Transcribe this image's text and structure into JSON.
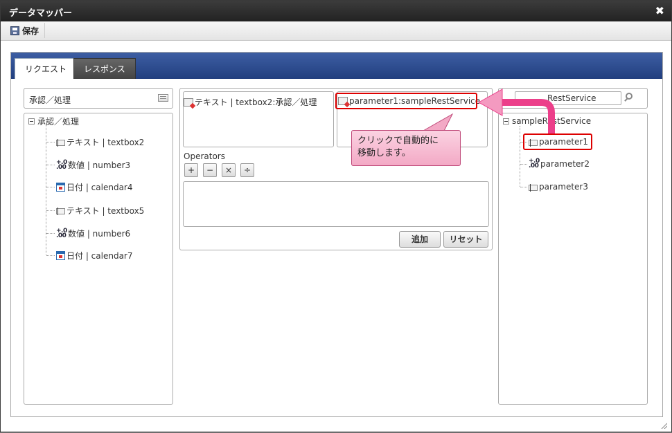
{
  "window": {
    "title": "データマッパー",
    "close_glyph": "✖"
  },
  "toolbar": {
    "save_label": "保存"
  },
  "tabs": [
    {
      "label": "リクエスト",
      "active": true
    },
    {
      "label": "レスポンス",
      "active": false
    }
  ],
  "left_panel": {
    "header": "承認／処理",
    "tree_root": "承認／処理",
    "items": [
      {
        "icon": "text-field-icon",
        "label": "テキスト | textbox2"
      },
      {
        "icon": "number-field-icon",
        "label": "数値 | number3"
      },
      {
        "icon": "calendar-icon",
        "label": "日付 | calendar4"
      },
      {
        "icon": "text-field-icon",
        "label": "テキスト | textbox5"
      },
      {
        "icon": "number-field-icon",
        "label": "数値 | number6"
      },
      {
        "icon": "calendar-icon",
        "label": "日付 | calendar7"
      }
    ]
  },
  "middle": {
    "source_mapping": "テキスト | textbox2:承認／処理",
    "target_mapping": "parameter1:sampleRestService",
    "operators_label": "Operators",
    "operators": [
      "+",
      "−",
      "×",
      "÷"
    ],
    "add_button": "追加",
    "reset_button": "リセット"
  },
  "right_panel": {
    "search_value": "RestService",
    "tree_root": "sampleRestService",
    "items": [
      {
        "icon": "text-field-icon",
        "label": "parameter1"
      },
      {
        "icon": "number-field-icon",
        "label": "parameter2"
      },
      {
        "icon": "text-field-icon",
        "label": "parameter3"
      }
    ]
  },
  "callout": {
    "line1": "クリックで自動的に",
    "line2": "移動します。"
  },
  "number_icon_glyph": {
    "top": "+.0",
    "bottom": ".00"
  },
  "colors": {
    "tab_bar": "#2d4c8f",
    "highlight": "#dd0000",
    "callout": "#f5b3cc",
    "arrow": "#ec3f8a"
  }
}
